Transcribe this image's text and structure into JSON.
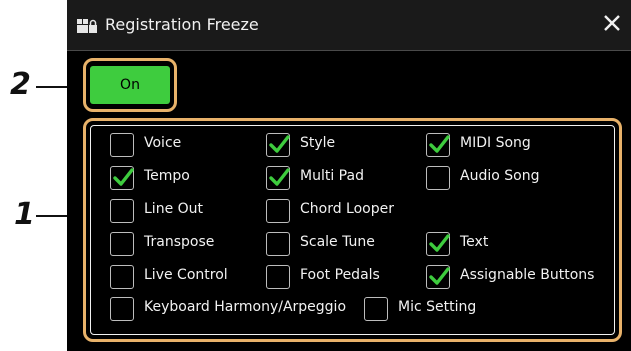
{
  "callouts": {
    "two": "2",
    "one": "1"
  },
  "window": {
    "title": "Registration Freeze",
    "title_icon": "registration-freeze-icon",
    "close_icon": "close-icon"
  },
  "on_button": {
    "label": "On",
    "active_color": "#3ecc3e"
  },
  "options": [
    {
      "label": "Voice",
      "checked": false
    },
    {
      "label": "Style",
      "checked": true
    },
    {
      "label": "MIDI Song",
      "checked": true
    },
    {
      "label": "Tempo",
      "checked": true
    },
    {
      "label": "Multi Pad",
      "checked": true
    },
    {
      "label": "Audio Song",
      "checked": false
    },
    {
      "label": "Line Out",
      "checked": false
    },
    {
      "label": "Chord Looper",
      "checked": false
    },
    {
      "label": "Transpose",
      "checked": false
    },
    {
      "label": "Scale Tune",
      "checked": false
    },
    {
      "label": "Text",
      "checked": true
    },
    {
      "label": "Live Control",
      "checked": false
    },
    {
      "label": "Foot Pedals",
      "checked": false
    },
    {
      "label": "Assignable Buttons",
      "checked": true
    },
    {
      "label": "Keyboard Harmony/Arpeggio",
      "checked": false
    },
    {
      "label": "Mic Setting",
      "checked": false
    }
  ],
  "colors": {
    "check": "#3ecc3e",
    "callout_frame": "#e8b26a",
    "screen_bg": "#000000"
  }
}
